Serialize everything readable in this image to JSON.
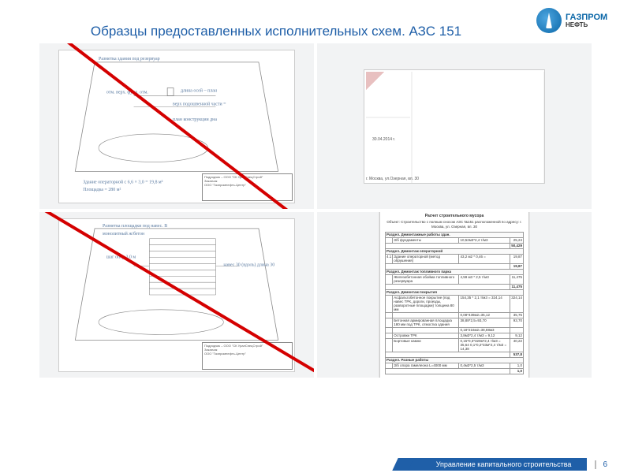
{
  "header": {
    "title": "Образцы предоставленных исполнительных схем. АЗС 151",
    "logo_main": "ГАЗПРОМ",
    "logo_sub": "НЕФТЬ"
  },
  "drawing_titleblock": {
    "contractor_label": "Подрядчик – ООО \"СК УралСпецСтрой\"",
    "customer_label": "Заказчик",
    "customer_name": "ООО \"Газпромнефть-Центр\""
  },
  "annotations": {
    "scan_date": "30.04.2014 г.",
    "scan_addr": "г. Москва, ул.Озерная, вл. 30"
  },
  "table_doc": {
    "title": "Расчет строительного мусора",
    "subtitle": "Объект: Строительство с полным сносом АЗС №151 расположенной по адресу: г. Москва, ул. Озерная, вл. 30",
    "sections": [
      {
        "name": "Раздел. Демонтажные работы здан."
      },
      {
        "rows": [
          [
            "",
            "З/б фундаменты",
            "10,52м3*2,4 т/м3",
            "25,24"
          ]
        ],
        "total": "50,429"
      },
      {
        "name": "Раздел. Демонтаж операторной"
      },
      {
        "rows": [
          [
            "4.1",
            "Здание операторной (метод обрушения)",
            "43,2 м2 * 0,46 =",
            "19,87"
          ]
        ],
        "total": "19,87"
      },
      {
        "name": "Раздел. Демонтаж топливного парка"
      },
      {
        "rows": [
          [
            "",
            "Железобетонная обойма топливного резервуара",
            "4,59 м3 * 2,5 т/м3",
            "11,475"
          ]
        ],
        "total": "11,475"
      },
      {
        "name": "Раздел. Демонтаж покрытия"
      },
      {
        "rows": [
          [
            "",
            "Асфальтобетонное покрытие (под навес ТРК, дороги, проезды, разворотные площадки) толщина 80 мм",
            "154,35 * 2,1 т/м3 = 324,14",
            "324,14"
          ],
          [
            "",
            "",
            "0,08*439м2=35,12",
            "35,75"
          ],
          [
            "",
            "Бетонная армированная площадка 180 мм под ТРК, отмостка здания",
            "38,88*2,5=93,70",
            "93,70"
          ],
          [
            "",
            "",
            "0,18*216м2=38,88м3",
            ""
          ],
          [
            "",
            "Островки ТРК",
            "3,8м3*2,4 т/м3 = 9,12",
            "9,12"
          ],
          [
            "",
            "Бортовые камни",
            "0,15*0,3*320м*2,4 т/м3 = 35,64  0,1*0,2*33м*2,4 т/м3 = 14,38",
            "40,22"
          ]
        ],
        "total": "537,8"
      },
      {
        "name": "Раздел. Разные работы"
      },
      {
        "rows": [
          [
            "",
            "З/б опора гамелеона L=4000 мм",
            "0,4м3*2,5 т/м3",
            "1,0"
          ]
        ],
        "total": "1,0"
      }
    ]
  },
  "footer": {
    "label": "Управление капитального строительства",
    "page": "6"
  }
}
